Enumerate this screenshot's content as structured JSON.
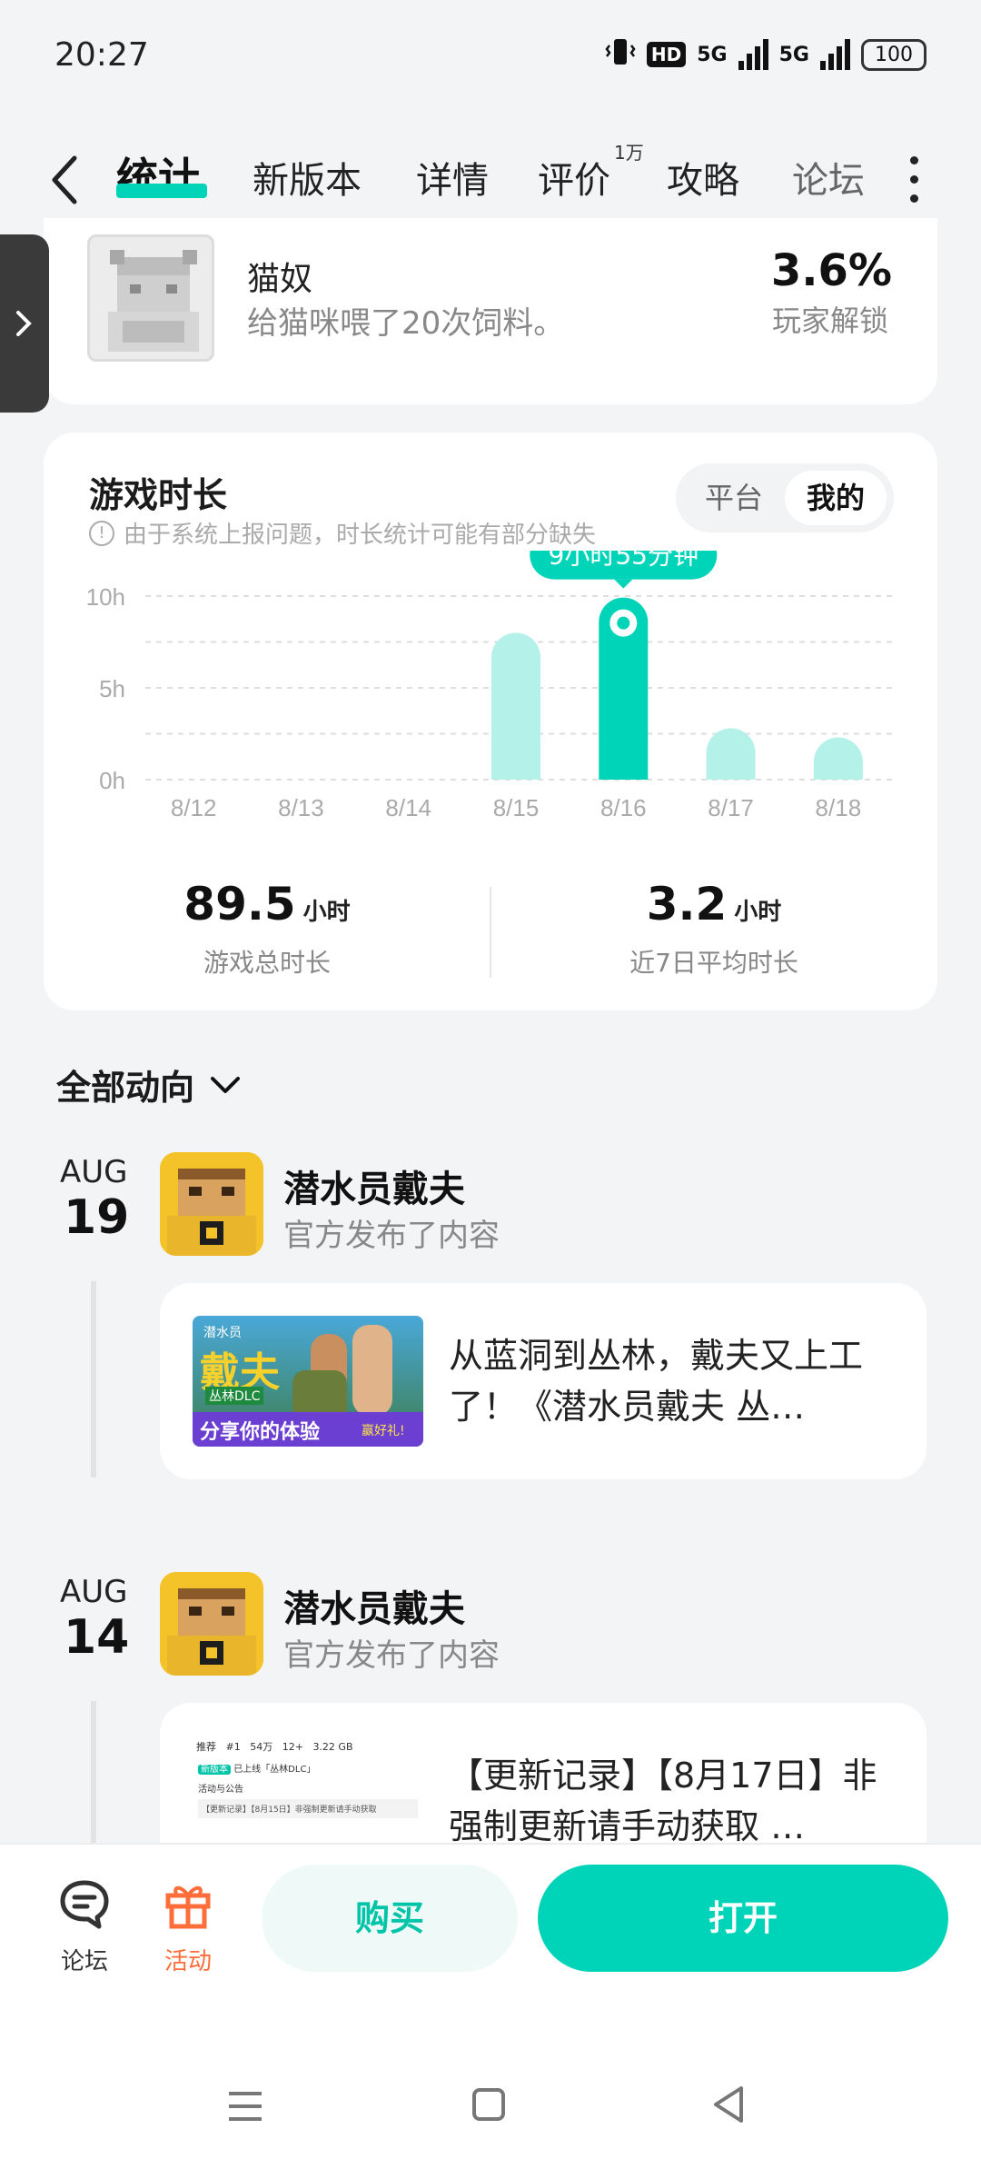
{
  "status": {
    "time": "20:27",
    "hd_label": "HD",
    "net1": "5G",
    "net2": "5G",
    "battery": "100"
  },
  "nav": {
    "tabs": [
      {
        "label": "统计"
      },
      {
        "label": "新版本"
      },
      {
        "label": "详情"
      },
      {
        "label": "评价",
        "badge": "1万"
      },
      {
        "label": "攻略"
      },
      {
        "label": "论坛"
      }
    ],
    "active_color": "#00d4b8"
  },
  "achievement": {
    "title": "猫奴",
    "desc": "给猫咪喂了20次饲料。",
    "percent": "3.6%",
    "percent_label": "玩家解锁"
  },
  "playtime": {
    "title": "游戏时长",
    "note": "由于系统上报问题，时长统计可能有部分缺失",
    "toggle": {
      "left": "平台",
      "right": "我的"
    },
    "highlight_label": "9小时55分钟",
    "total": {
      "value": "89.5",
      "unit": "小时",
      "label": "游戏总时长"
    },
    "average": {
      "value": "3.2",
      "unit": "小时",
      "label": "近7日平均时长"
    }
  },
  "chart_data": {
    "type": "bar",
    "categories": [
      "8/12",
      "8/13",
      "8/14",
      "8/15",
      "8/16",
      "8/17",
      "8/18"
    ],
    "values": [
      0,
      0,
      0,
      8.0,
      9.92,
      2.8,
      2.3
    ],
    "y_ticks": [
      "0h",
      "5h",
      "10h"
    ],
    "ylim": [
      0,
      10
    ],
    "highlight_index": 4,
    "grid": true,
    "colors": {
      "bar": "#b4f1e8",
      "highlight": "#00d4b8"
    }
  },
  "feed": {
    "header": "全部动向",
    "items": [
      {
        "month": "AUG",
        "day": "19",
        "author": "潜水员戴夫",
        "action": "官方发布了内容",
        "post_text": "从蓝洞到丛林，戴夫又上工了！《潜水员戴夫 丛…",
        "thumb": {
          "small": "潜水员",
          "big": "戴夫",
          "sub": "丛林DLC",
          "cta": "分享你的体验",
          "cta2": "赢好礼!"
        }
      },
      {
        "month": "AUG",
        "day": "14",
        "author": "潜水员戴夫",
        "action": "官方发布了内容",
        "post_text": "【更新记录】【8月17日】非强制更新请手动获取 …",
        "thumb": {
          "line1": "推荐",
          "stat1": "#1",
          "stat2": "54万",
          "stat3": "12+",
          "stat4": "3.22 GB",
          "tag": "新版本",
          "line2": "已上线「丛林DLC」",
          "line3": "活动与公告",
          "line4": "【更新记录】【8月15日】非强制更新请手动获取"
        }
      }
    ]
  },
  "bottom": {
    "forum": "论坛",
    "activity": "活动",
    "buy": "购买",
    "open": "打开"
  }
}
